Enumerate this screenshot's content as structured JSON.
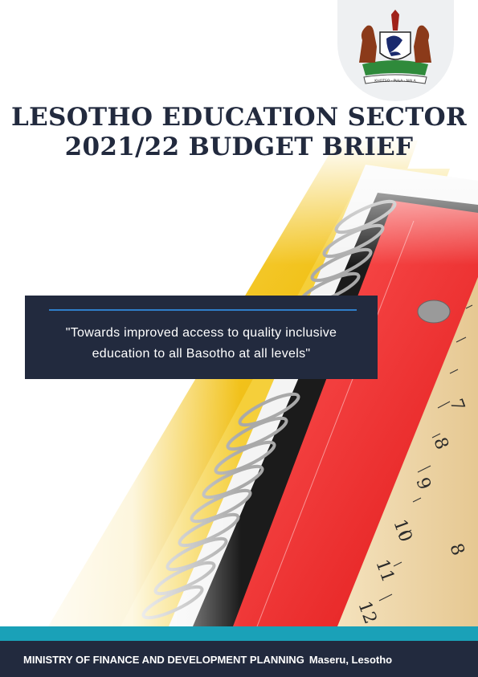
{
  "cover": {
    "title_line1": "LESOTHO EDUCATION SECTOR",
    "title_line2": "2021/22 BUDGET BRIEF",
    "quote_line1": "\"Towards improved access to quality inclusive",
    "quote_line2": "education to all Basotho at all levels\"",
    "crest_motto": "KHOTSO · PULA · NALA"
  },
  "footer": {
    "ministry": "MINISTRY OF FINANCE AND DEVELOPMENT PLANNING",
    "location": "Maseru, Lesotho"
  },
  "colors": {
    "navy": "#222a3e",
    "teal": "#1aa1b8",
    "accent_rule": "#2f7ec9",
    "yellow_folder": "#f2c21a",
    "red_notebook": "#ef2b2b",
    "ruler_wood": "#efd8ad"
  },
  "icons": [
    "coat-of-arms-icon"
  ]
}
